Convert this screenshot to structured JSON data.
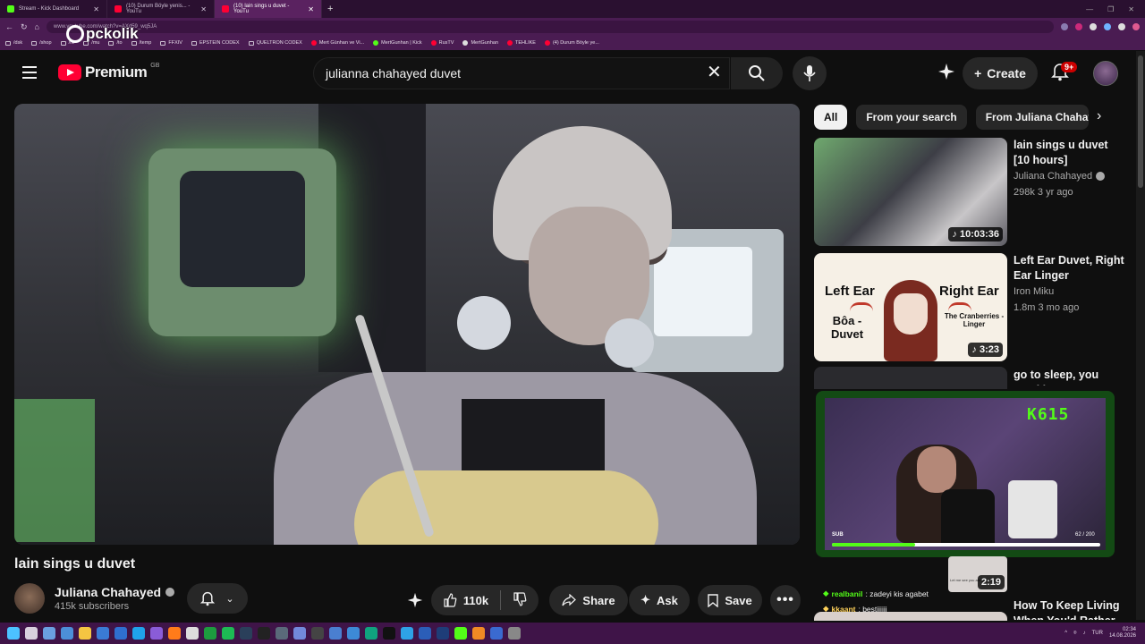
{
  "browser": {
    "tabs": [
      {
        "label": "Stream - Kick Dashboard",
        "color": "#53fc18"
      },
      {
        "label": "(10) Durum Böyle yenis... - YouTu",
        "color": "#ff0033"
      },
      {
        "label": "(10) lain sings u duvet - YouTu",
        "color": "#ff0033"
      }
    ],
    "url": "www.youtube.com/watch?v=AXd59_wq5JA",
    "bookmarks": [
      "/dsk",
      "/shop",
      "/lvl",
      "/mu",
      "/to",
      "/temp",
      "FFXIV",
      "EPSTEIN CODEX",
      "QUELTRON CODEX",
      "Mert Günhan ve Vi...",
      "MertGunhan | Kick",
      "RusTV",
      "MertGunhan",
      "TEHLIKE",
      "(4) Durum Böyle ye..."
    ],
    "watermark": "pckolik"
  },
  "youtube": {
    "logo_text": "Premium",
    "country": "GB",
    "search_query": "julianna chahayed duvet",
    "create_label": "Create",
    "notif_badge": "9+"
  },
  "video": {
    "title": "lain sings u duvet",
    "channel": "Juliana Chahayed",
    "subscribers": "415k subscribers",
    "likes": "110k",
    "share_label": "Share",
    "ask_label": "Ask",
    "save_label": "Save"
  },
  "sidebar": {
    "chips": [
      "All",
      "From your search",
      "From Juliana Chahayed"
    ],
    "recs": [
      {
        "title": "lain sings u duvet [10 hours]",
        "channel": "Juliana Chahayed",
        "meta": "298k  3 yr ago",
        "duration": "10:03:36"
      },
      {
        "title": "Left Ear Duvet, Right Ear Linger",
        "channel": "Iron Miku",
        "meta": "1.8m  3 mo ago",
        "duration": "3:23"
      },
      {
        "title": "go to sleep, you need it"
      },
      {
        "title": "How To Keep Living When You'd Rather",
        "duration": "2:19"
      }
    ],
    "thumb2": {
      "left": "Left Ear",
      "right": "Right Ear",
      "left_sub": "Bôa - Duvet",
      "right_sub": "The Cranberries - Linger"
    }
  },
  "overlay": {
    "counter": "K615",
    "sub_label": "SUB",
    "sub_count": "62 / 200",
    "sub_progress": 0.31,
    "chat": [
      {
        "user": "realbanil",
        "text": ": zadeyi kis agabet"
      },
      {
        "user": "kkaant",
        "text": ": bestiiiiii"
      }
    ],
    "chat_thumb_caption": "Let me see you are you waiting..."
  },
  "taskbar": {
    "lang": "TUR",
    "time": "02:34",
    "date": "14.08.2026"
  }
}
